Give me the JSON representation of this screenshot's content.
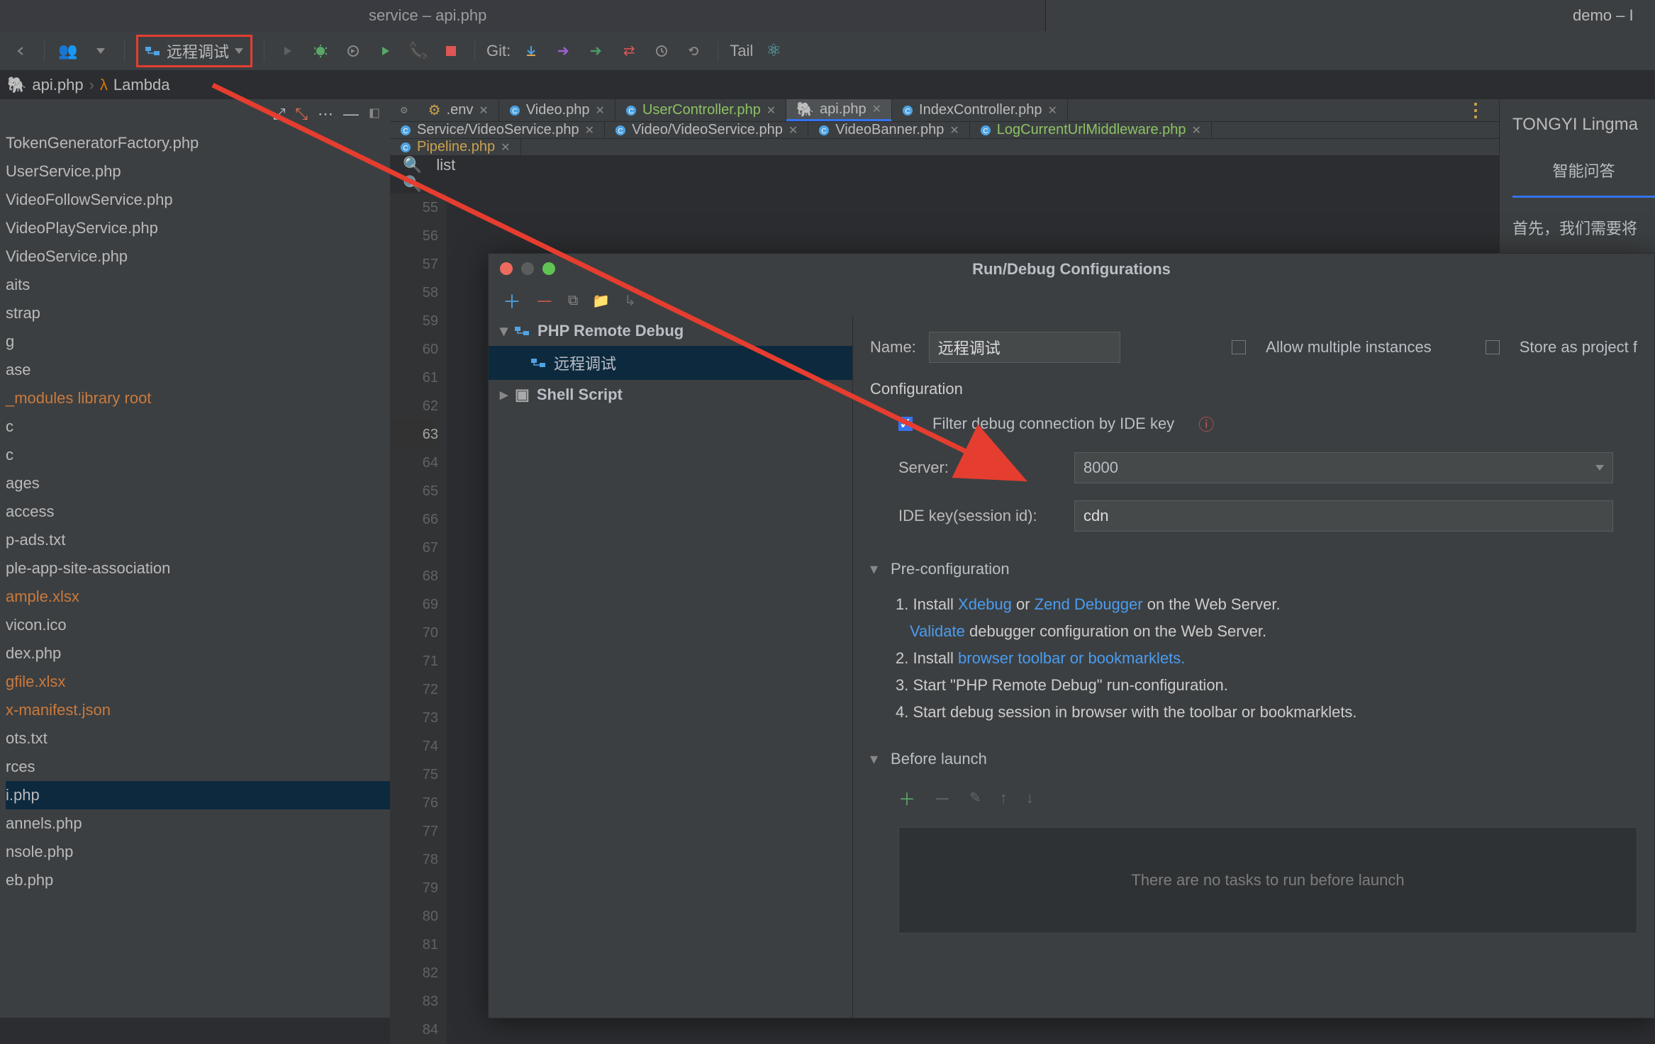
{
  "window": {
    "title": "service – api.php",
    "right_title": "demo – I"
  },
  "toolbar": {
    "run_config_label": "远程调试",
    "git_label": "Git:",
    "tail_label": "Tail"
  },
  "breadcrumb": {
    "file": "api.php",
    "sep": "›",
    "symbol": "Lambda"
  },
  "project_tree": [
    {
      "t": "TokenGeneratorFactory.php"
    },
    {
      "t": "UserService.php"
    },
    {
      "t": "VideoFollowService.php"
    },
    {
      "t": "VideoPlayService.php"
    },
    {
      "t": "VideoService.php"
    },
    {
      "t": "aits"
    },
    {
      "t": "strap"
    },
    {
      "t": "g"
    },
    {
      "t": "ase"
    },
    {
      "t": "_modules library root",
      "cls": "orange"
    },
    {
      "t": "c"
    },
    {
      "t": "c"
    },
    {
      "t": "ages"
    },
    {
      "t": " "
    },
    {
      "t": "access"
    },
    {
      "t": "p-ads.txt"
    },
    {
      "t": "ple-app-site-association"
    },
    {
      "t": "ample.xlsx",
      "cls": "orange"
    },
    {
      "t": "vicon.ico"
    },
    {
      "t": "dex.php"
    },
    {
      "t": "gfile.xlsx",
      "cls": "orange"
    },
    {
      "t": "x-manifest.json",
      "cls": "orange"
    },
    {
      "t": "ots.txt"
    },
    {
      "t": "rces"
    },
    {
      "t": "i.php",
      "cls": "selected"
    },
    {
      "t": "annels.php"
    },
    {
      "t": "nsole.php"
    },
    {
      "t": "eb.php"
    }
  ],
  "tabs_row1": [
    {
      "label": ".env",
      "icon": "env",
      "close": true
    },
    {
      "label": "Video.php",
      "icon": "php-c",
      "close": true
    },
    {
      "label": "UserController.php",
      "icon": "php-c",
      "close": true,
      "green": true
    },
    {
      "label": "api.php",
      "icon": "elephant",
      "close": true,
      "active": true
    },
    {
      "label": "IndexController.php",
      "icon": "php-c",
      "close": true
    }
  ],
  "tabs_row2": [
    {
      "label": "Service/VideoService.php",
      "icon": "php-c",
      "close": true
    },
    {
      "label": "Video/VideoService.php",
      "icon": "php-c",
      "close": true
    },
    {
      "label": "VideoBanner.php",
      "icon": "php-c",
      "close": true
    },
    {
      "label": "LogCurrentUrlMiddleware.php",
      "icon": "php-c",
      "close": true,
      "green": true
    }
  ],
  "tabs_row3": [
    {
      "label": "Pipeline.php",
      "icon": "php-c",
      "close": true,
      "yellow": true
    }
  ],
  "search_box": {
    "placeholder": "list"
  },
  "gutter": {
    "start": 55,
    "end": 84,
    "highlight": 63
  },
  "right_panel": {
    "title": "TONGYI Lingma",
    "active_tab": "智能问答",
    "body_start": "首先，我们需要将"
  },
  "dialog": {
    "title": "Run/Debug Configurations",
    "tree": [
      {
        "label": "PHP Remote Debug",
        "kind": "group",
        "expanded": true
      },
      {
        "label": "远程调试",
        "kind": "item",
        "selected": true
      },
      {
        "label": "Shell Script",
        "kind": "group",
        "expanded": false
      }
    ],
    "name_label": "Name:",
    "name_value": "远程调试",
    "allow_multiple": "Allow multiple instances",
    "store_as_project": "Store as project f",
    "configuration_header": "Configuration",
    "filter_label": "Filter debug connection by IDE key",
    "server_label": "Server:",
    "server_value": "8000",
    "idekey_label": "IDE key(session id):",
    "idekey_value": "cdn",
    "preconf_header": "Pre-configuration",
    "pre1_a": "1. Install ",
    "pre1_xdebug": "Xdebug",
    "pre1_or": " or ",
    "pre1_zend": "Zend Debugger",
    "pre1_b": " on the Web Server.",
    "pre1_validate": "Validate",
    "pre1_c": " debugger configuration on the Web Server.",
    "pre2_a": "2. Install ",
    "pre2_link": "browser toolbar or bookmarklets.",
    "pre3": "3. Start \"PHP Remote Debug\" run-configuration.",
    "pre4": "4. Start debug session in browser with the toolbar or bookmarklets.",
    "before_header": "Before launch",
    "before_empty": "There are no tasks to run before launch"
  },
  "icons": {
    "remote": "remote-debug-icon"
  }
}
